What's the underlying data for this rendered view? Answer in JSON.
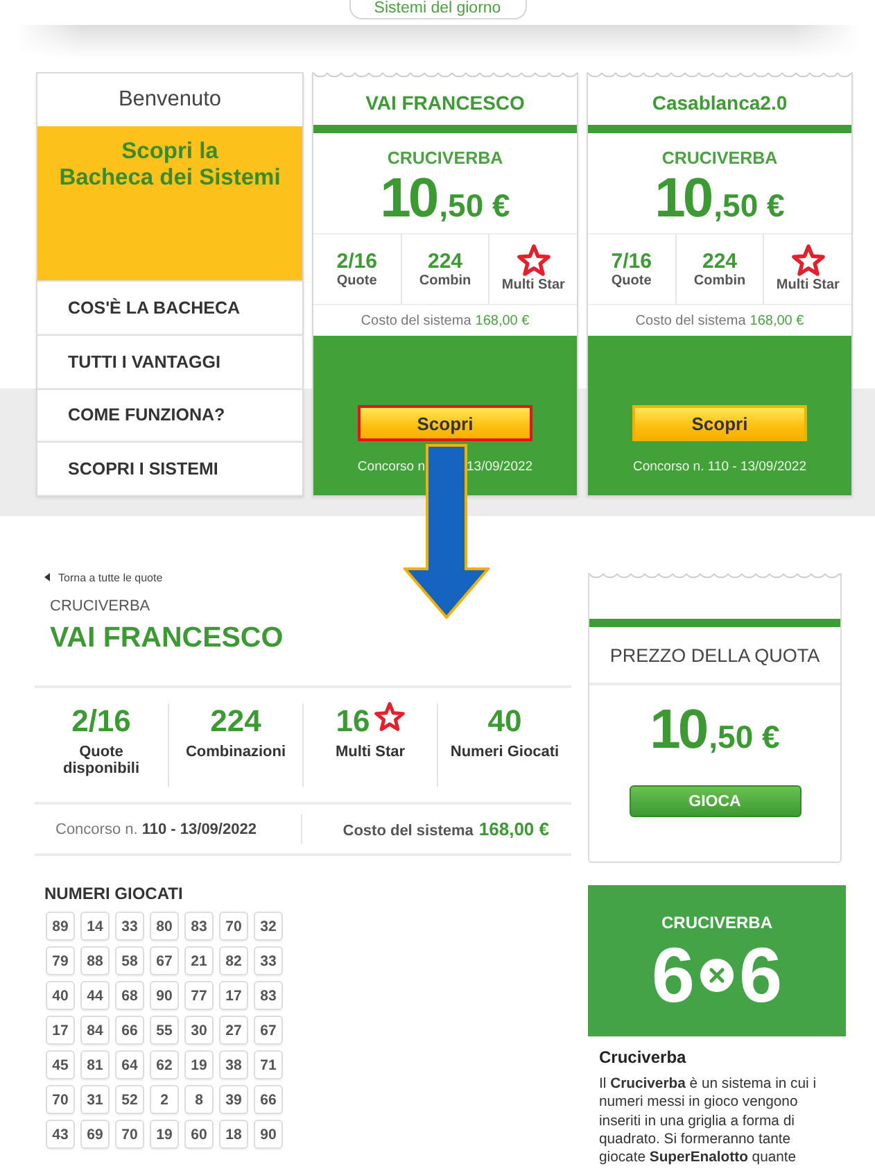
{
  "top_tab": {
    "label": "Sistemi del giorno"
  },
  "sidebar": {
    "title": "Benvenuto",
    "promo_lines": [
      "Scopri la",
      "Bacheca dei Sistemi"
    ],
    "items": [
      "COS'È LA BACHECA",
      "TUTTI I VANTAGGI",
      "COME FUNZIONA?",
      "SCOPRI I SISTEMI"
    ]
  },
  "systems": [
    {
      "name": "VAI FRANCESCO",
      "game": "CRUCIVERBA",
      "price_main": "10",
      "price_decimal": ",50 €",
      "stats": [
        {
          "kind": "number",
          "value": "2/16",
          "label": "Quote"
        },
        {
          "kind": "number",
          "value": "224",
          "label": "Combin"
        },
        {
          "kind": "star",
          "label": "Multi Star"
        }
      ],
      "cost_label": "Costo del sistema",
      "cost_value": "168,00 €",
      "button": "Scopri",
      "highlighted": true,
      "contest": [
        "Concorso n",
        "13/09/2022"
      ]
    },
    {
      "name": "Casablanca2.0",
      "game": "CRUCIVERBA",
      "price_main": "10",
      "price_decimal": ",50 €",
      "stats": [
        {
          "kind": "number",
          "value": "7/16",
          "label": "Quote"
        },
        {
          "kind": "number",
          "value": "224",
          "label": "Combin"
        },
        {
          "kind": "star",
          "label": "Multi Star"
        }
      ],
      "cost_label": "Costo del sistema",
      "cost_value": "168,00 €",
      "button": "Scopri",
      "highlighted": false,
      "contest": [
        "Concorso n. 110 - 13/09/2022"
      ]
    }
  ],
  "detail": {
    "back_link": "Torna a tutte le quote",
    "game": "CRUCIVERBA",
    "name": "VAI FRANCESCO",
    "stats": [
      {
        "kind": "number",
        "value": "2/16",
        "label": "Quote disponibili"
      },
      {
        "kind": "number",
        "value": "224",
        "label": "Combinazioni"
      },
      {
        "kind": "star",
        "value": "16",
        "label": "Multi Star"
      },
      {
        "kind": "number",
        "value": "40",
        "label": "Numeri Giocati"
      }
    ],
    "contest": "Concorso n. **110 - 13/09/2022**",
    "cost_label": "Costo del sistema",
    "cost_value": "168,00 €",
    "numbers_title": "NUMERI GIOCATI",
    "numbers": [
      [
        "89",
        "14",
        "33",
        "80",
        "83",
        "70",
        "32"
      ],
      [
        "79",
        "88",
        "58",
        "67",
        "21",
        "82",
        "33"
      ],
      [
        "40",
        "44",
        "68",
        "90",
        "77",
        "17",
        "83"
      ],
      [
        "17",
        "84",
        "66",
        "55",
        "30",
        "27",
        "67"
      ],
      [
        "45",
        "81",
        "64",
        "62",
        "19",
        "38",
        "71"
      ],
      [
        "70",
        "31",
        "52",
        "2",
        "8",
        "39",
        "66"
      ],
      [
        "43",
        "69",
        "70",
        "19",
        "60",
        "18",
        "90"
      ]
    ]
  },
  "price_card": {
    "title": "PREZZO DELLA QUOTA",
    "price_main": "10",
    "price_decimal": ",50 €",
    "button": "GIOCA"
  },
  "feature": {
    "game": "CRUCIVERBA",
    "rows": "6",
    "columns": "6"
  },
  "info": {
    "title": "Cruciverba",
    "text": "Il **Cruciverba** è un sistema in cui i numeri messi in gioco vengono inseriti in una griglia a forma di quadrato. Si formeranno tante giocate **SuperEnalotto** quante"
  }
}
